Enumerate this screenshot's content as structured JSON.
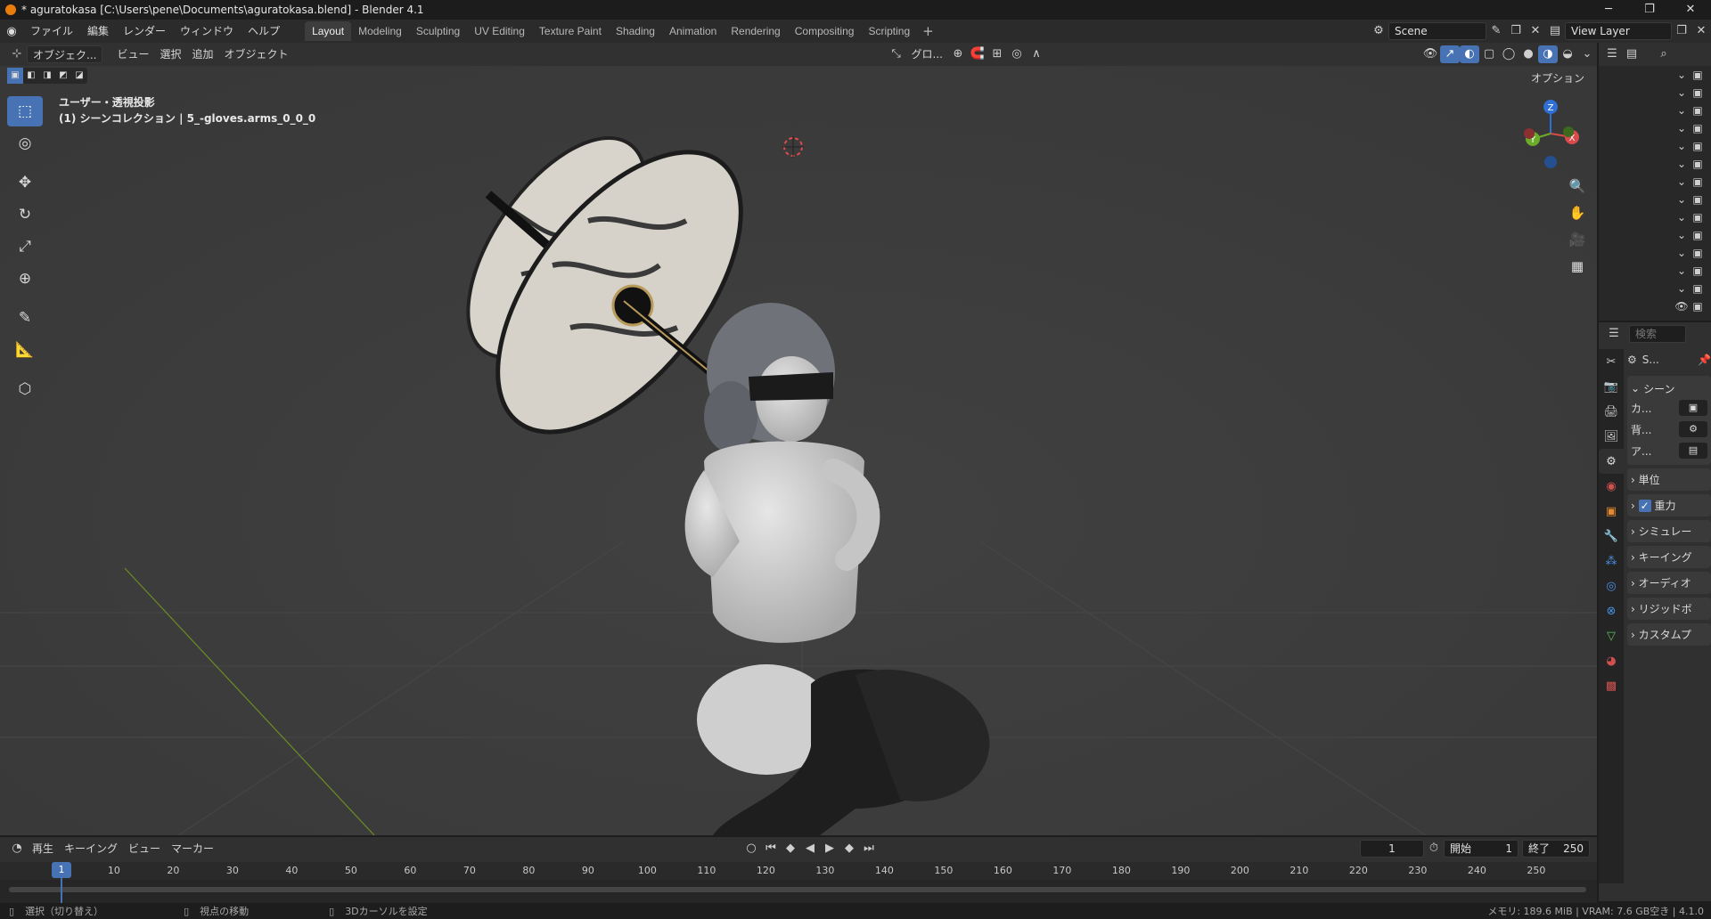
{
  "window": {
    "title": "* aguratokasa [C:\\Users\\pene\\Documents\\aguratokasa.blend] - Blender 4.1",
    "controls": [
      "─",
      "❐",
      "✕"
    ]
  },
  "menu": {
    "items": [
      "ファイル",
      "編集",
      "レンダー",
      "ウィンドウ",
      "ヘルプ"
    ]
  },
  "workspaces": {
    "tabs": [
      "Layout",
      "Modeling",
      "Sculpting",
      "UV Editing",
      "Texture Paint",
      "Shading",
      "Animation",
      "Rendering",
      "Compositing",
      "Scripting"
    ],
    "add": "+"
  },
  "scene": {
    "name": "Scene",
    "view_layer": "View Layer"
  },
  "viewport": {
    "mode": "オブジェク...",
    "menus": [
      "ビュー",
      "選択",
      "追加",
      "オブジェクト"
    ],
    "transform_orientation": "グロ...",
    "options": "オプション",
    "info_line1": "ユーザー・透視投影",
    "info_line2": "(1) シーンコレクション | 5_-gloves.arms_0_0_0",
    "gizmo": {
      "x": "X",
      "y": "Y",
      "z": "Z"
    }
  },
  "properties": {
    "search_placeholder": "検索",
    "header_label": "S...",
    "scene_panel": "シーン",
    "scene_rows": [
      "カ...",
      "背...",
      "ア..."
    ],
    "panels": [
      "単位",
      "重力",
      "シミュレー",
      "キーイング",
      "オーディオ",
      "リジッドボ",
      "カスタムプ"
    ],
    "gravity_checked": true
  },
  "timeline": {
    "menus": [
      "再生",
      "キーイング",
      "ビュー",
      "マーカー"
    ],
    "current_frame": "1",
    "start_label": "開始",
    "start_value": "1",
    "end_label": "終了",
    "end_value": "250",
    "playhead": "1",
    "ticks": [
      "10",
      "20",
      "30",
      "40",
      "50",
      "60",
      "70",
      "80",
      "90",
      "100",
      "110",
      "120",
      "130",
      "140",
      "150",
      "160",
      "170",
      "180",
      "190",
      "200",
      "210",
      "220",
      "230",
      "240",
      "250"
    ]
  },
  "status": {
    "hint1": "選択（切り替え）",
    "hint2": "視点の移動",
    "hint3": "3Dカーソルを設定",
    "memory": "メモリ: 189.6 MiB | VRAM: 7.6 GB空き | 4.1.0"
  },
  "colors": {
    "accent": "#4772b3",
    "viewport_bg": "#3d3d3d",
    "panel_bg": "#303030"
  }
}
